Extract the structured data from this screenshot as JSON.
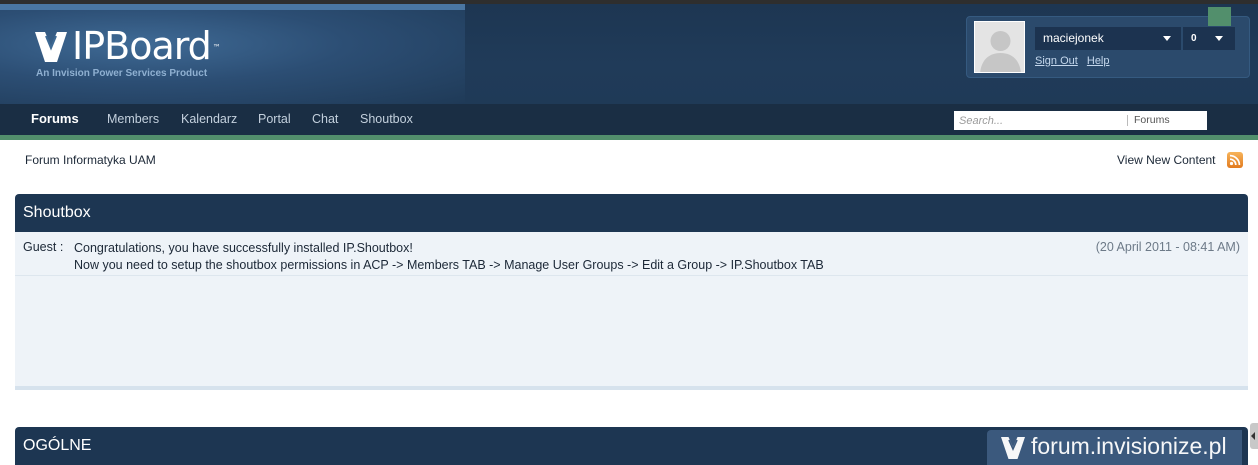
{
  "header": {
    "logo_text": "IPBoard",
    "logo_tm": "™",
    "logo_subtitle": "An Invision Power Services Product"
  },
  "user": {
    "username": "maciejonek",
    "notifications": "0",
    "sign_out": "Sign Out",
    "help": "Help"
  },
  "nav": {
    "tabs": [
      {
        "label": "Forums",
        "active": true
      },
      {
        "label": "Members"
      },
      {
        "label": "Kalendarz"
      },
      {
        "label": "Portal"
      },
      {
        "label": "Chat"
      },
      {
        "label": "Shoutbox"
      }
    ]
  },
  "search": {
    "placeholder": "Search...",
    "scope": "Forums"
  },
  "breadcrumb": {
    "home": "Forum Informatyka UAM",
    "view_new_content": "View New Content"
  },
  "shoutbox": {
    "title": "Shoutbox",
    "shouts": [
      {
        "author": "Guest :",
        "line1": "Congratulations, you have successfully installed IP.Shoutbox!",
        "line2": "Now you need to setup the shoutbox permissions in ACP -> Members TAB -> Manage User Groups -> Edit a Group -> IP.Shoutbox TAB",
        "time": "(20 April 2011 - 08:41 AM)"
      }
    ]
  },
  "category": {
    "title": "OGÓLNE"
  },
  "watermark": {
    "text": "forum.invisionize.pl"
  },
  "colors": {
    "header_bg": "#1d3652",
    "navbar_bg": "#1a2e44",
    "accent_green": "#528f6c",
    "shout_bg": "#eef3f8"
  },
  "icons": [
    "ipboard-logo-icon",
    "avatar-placeholder-icon",
    "caret-down-icon",
    "rss-icon",
    "watermark-logo-icon",
    "side-tab-arrow-icon"
  ]
}
